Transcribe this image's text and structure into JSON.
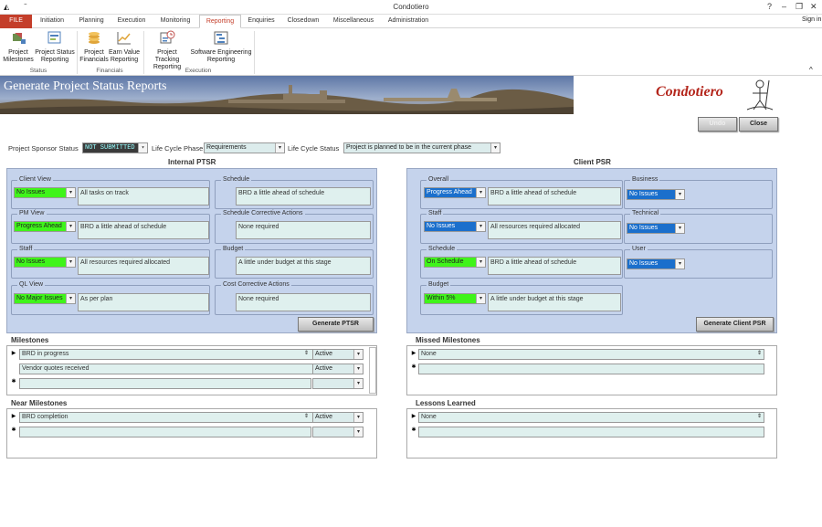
{
  "window": {
    "title": "Condotiero",
    "help": "?",
    "minimize": "–",
    "restore": "❐",
    "close": "✕",
    "signin": "Sign in"
  },
  "tabs": [
    "FILE",
    "Initiation",
    "Planning",
    "Execution",
    "Monitoring",
    "Reporting",
    "Enquiries",
    "Closedown",
    "Miscellaneous",
    "Administration"
  ],
  "ribbon": {
    "buttons": [
      {
        "l1": "Project",
        "l2": "Milestones"
      },
      {
        "l1": "Project Status",
        "l2": "Reporting"
      },
      {
        "l1": "Project",
        "l2": "Financials"
      },
      {
        "l1": "Earn Value",
        "l2": "Reporting"
      },
      {
        "l1": "Project Tracking",
        "l2": "Reporting"
      },
      {
        "l1": "Software Engineering",
        "l2": "Reporting"
      }
    ],
    "groups": [
      "Status",
      "Financials",
      "Execution"
    ]
  },
  "banner": {
    "title": "Generate Project Status Reports",
    "logo": "Condotiero"
  },
  "actions": {
    "undo": "Undo",
    "close": "Close"
  },
  "topfields": {
    "sponsor_label": "Project Sponsor Status",
    "sponsor_value": "NOT SUBMITTED",
    "phase_label": "Life Cycle Phase",
    "phase_value": "Requirements",
    "status_label": "Life Cycle Status",
    "status_value": "Project is planned to be in the current phase"
  },
  "internal": {
    "title": "Internal PTSR",
    "client_view": {
      "label": "Client View",
      "value": "No Issues",
      "comment": "All tasks on track"
    },
    "pm_view": {
      "label": "PM View",
      "value": "Progress Ahead",
      "comment": "BRD a little ahead of schedule"
    },
    "staff": {
      "label": "Staff",
      "value": "No Issues",
      "comment": "All resources required allocated"
    },
    "ql_view": {
      "label": "QL View",
      "value": "No Major Issues",
      "comment": "As per plan"
    },
    "schedule": {
      "label": "Schedule",
      "comment": "BRD a little ahead of schedule"
    },
    "sched_actions": {
      "label": "Schedule Corrective Actions",
      "comment": "None required"
    },
    "budget": {
      "label": "Budget",
      "comment": "A little under budget at this stage"
    },
    "cost_actions": {
      "label": "Cost Corrective Actions",
      "comment": "None required"
    },
    "button": "Generate PTSR"
  },
  "client": {
    "title": "Client PSR",
    "overall": {
      "label": "Overall",
      "value": "Progress Ahead",
      "comment": "BRD a little ahead of schedule"
    },
    "staff": {
      "label": "Staff",
      "value": "No Issues",
      "comment": "All resources required allocated"
    },
    "schedule": {
      "label": "Schedule",
      "value": "On Schedule",
      "comment": "BRD a little ahead of schedule"
    },
    "budget": {
      "label": "Budget",
      "value": "Within 5%",
      "comment": "A little under budget at this stage"
    },
    "business": {
      "label": "Business",
      "value": "No Issues"
    },
    "technical": {
      "label": "Technical",
      "value": "No Issues"
    },
    "user": {
      "label": "User",
      "value": "No Issues"
    },
    "button": "Generate Client PSR"
  },
  "milestones": {
    "title": "Milestones",
    "rows": [
      {
        "name": "BRD in progress",
        "status": "Active"
      },
      {
        "name": "Vendor quotes received",
        "status": "Active"
      }
    ]
  },
  "near": {
    "title": "Near Milestones",
    "rows": [
      {
        "name": "BRD completion",
        "status": "Active"
      }
    ]
  },
  "missed": {
    "title": "Missed Milestones",
    "rows": [
      {
        "name": "None"
      }
    ]
  },
  "lessons": {
    "title": "Lessons Learned",
    "rows": [
      {
        "name": "None"
      }
    ]
  },
  "colors": {
    "accent": "#c43e2a",
    "panel": "#c5d3ec",
    "green": "#3ff41a",
    "blue": "#1b6fcc"
  }
}
